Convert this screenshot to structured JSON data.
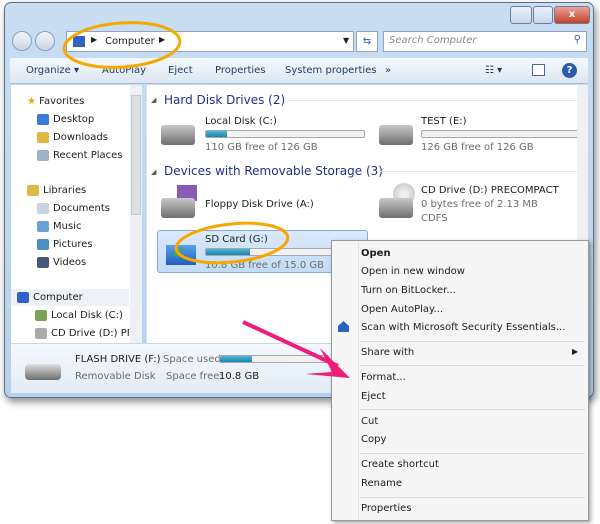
{
  "window": {
    "controls": [
      "minimize",
      "maximize",
      "close"
    ]
  },
  "address": {
    "location": "Computer",
    "search_placeholder": "Search Computer"
  },
  "toolbar": {
    "items": [
      "Organize",
      "AutoPlay",
      "Eject",
      "Properties",
      "System properties"
    ],
    "more": "»"
  },
  "sidebar": {
    "favorites": "Favorites",
    "fav_items": [
      "Desktop",
      "Downloads",
      "Recent Places"
    ],
    "libraries": "Libraries",
    "lib_items": [
      "Documents",
      "Music",
      "Pictures",
      "Videos"
    ],
    "computer": "Computer",
    "comp_items": [
      "Local Disk (C:)",
      "CD Drive (D:) PRE"
    ]
  },
  "content": {
    "hard_disks_header": "Hard Disk Drives (2)",
    "removable_header": "Devices with Removable Storage (3)",
    "drives": [
      {
        "name": "Local Disk (C:)",
        "info": "110 GB free of 126 GB",
        "used_fraction": 0.13
      },
      {
        "name": "TEST (E:)",
        "info": "126 GB free of 126 GB",
        "used_fraction": 0
      },
      {
        "name": "Floppy Disk Drive (A:)"
      },
      {
        "name": "CD Drive (D:) PRECOMPACT",
        "info": "0 bytes free of 2.13 MB",
        "fs": "CDFS"
      },
      {
        "name": "SD Card (G:)",
        "info": "10.8 GB free of 15.0 GB",
        "used_fraction": 0.28
      }
    ]
  },
  "details": {
    "name": "FLASH DRIVE (F:)",
    "type": "Removable Disk",
    "space_used_label": "Space used:",
    "space_free_label": "Space free:",
    "space_free": "10.8 GB",
    "used_fraction": 0.3
  },
  "context_menu": {
    "items": [
      "Open",
      "Open in new window",
      "Turn on BitLocker...",
      "Open AutoPlay...",
      "Scan with Microsoft Security Essentials...",
      "Share with",
      "Format...",
      "Eject",
      "Cut",
      "Copy",
      "Create shortcut",
      "Rename",
      "Properties"
    ]
  },
  "colors": {
    "annotation_circle": "#f5a800",
    "annotation_arrow": "#ee1c7a",
    "accent": "#1e3287"
  }
}
